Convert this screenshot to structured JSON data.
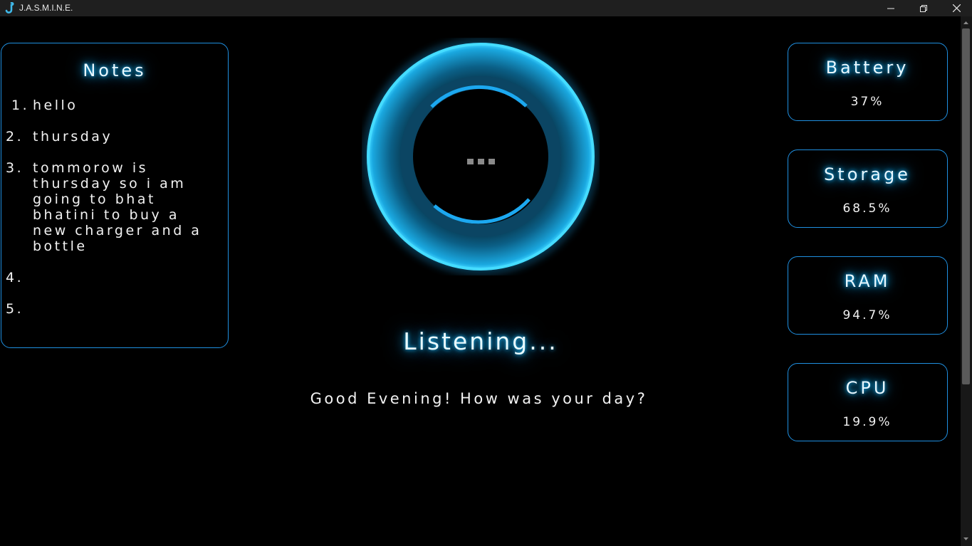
{
  "window": {
    "title": "J.A.S.M.I.N.E.",
    "icon": "jasmine-app-icon",
    "controls": {
      "minimize": "minimize-icon",
      "maximize": "restore-icon",
      "close": "close-icon"
    }
  },
  "notes": {
    "title": "Notes",
    "items": [
      {
        "num": "1.",
        "text": "hello"
      },
      {
        "num": "2.",
        "text": "thursday"
      },
      {
        "num": "3.",
        "text": "tommorow is thursday so i am going to bhat bhatini to buy a new charger and a bottle"
      },
      {
        "num": "4.",
        "text": ""
      },
      {
        "num": "5.",
        "text": ""
      }
    ]
  },
  "assistant": {
    "status": "Listening...",
    "greeting": "Good Evening! How was your day?",
    "indicator": "..."
  },
  "stats": {
    "battery": {
      "label": "Battery",
      "value": "37%"
    },
    "storage": {
      "label": "Storage",
      "value": "68.5%"
    },
    "ram": {
      "label": "RAM",
      "value": "94.7%"
    },
    "cpu": {
      "label": "CPU",
      "value": "19.9%"
    }
  },
  "colors": {
    "accent": "#1f8fe0",
    "glow": "#18b8ff",
    "background": "#000000",
    "titlebar": "#1f1f1f"
  }
}
